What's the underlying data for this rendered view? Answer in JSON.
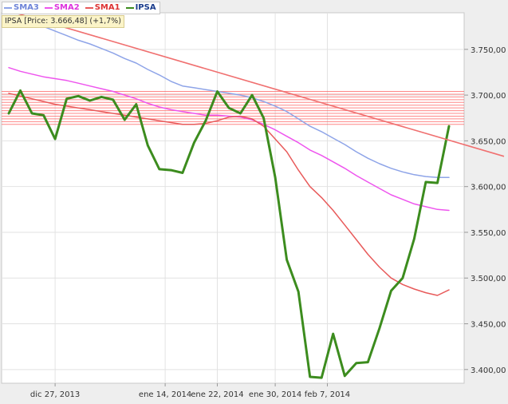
{
  "legend": [
    {
      "name": "SMA3",
      "color": "#8ea4e8"
    },
    {
      "name": "SMA2",
      "color": "#ee55ee"
    },
    {
      "name": "SMA1",
      "color": "#e85a5a"
    },
    {
      "name": "IPSA",
      "color": "#3c8c1e"
    }
  ],
  "price_tag": "IPSA [Price: 3.666,48] (+1,7%)",
  "chart_data": {
    "type": "line",
    "title": "",
    "xlabel": "",
    "ylabel": "",
    "ylim": [
      3385,
      3790
    ],
    "y_ticks": [
      3400,
      3450,
      3500,
      3550,
      3600,
      3650,
      3700,
      3750
    ],
    "y_tick_labels": [
      "3.400,00",
      "3.450,00",
      "3.500,00",
      "3.550,00",
      "3.600,00",
      "3.650,00",
      "3.700,00",
      "3.750,00"
    ],
    "x_tick_labels": [
      "dic 27, 2013",
      "ene 14, 2014",
      "ene 22, 2014",
      "ene 30, 2014",
      "feb 7, 2014"
    ],
    "x_tick_index": [
      4,
      13.5,
      18,
      23,
      27.5
    ],
    "grid": true,
    "legend_position": "top-left",
    "series": [
      {
        "name": "IPSA",
        "color": "#3c8c1e",
        "values": [
          3680,
          3705,
          3680,
          3678,
          3652,
          3696,
          3699,
          3694,
          3698,
          3695,
          3673,
          3690,
          3645,
          3619,
          3618,
          3615,
          3648,
          3672,
          3704,
          3686,
          3680,
          3700,
          3675,
          3610,
          3520,
          3485,
          3392,
          3391,
          3439,
          3393,
          3407,
          3408,
          3445,
          3486,
          3500,
          3543,
          3605,
          3604,
          3666
        ]
      },
      {
        "name": "SMA3",
        "color": "#8ea4e8",
        "values": [
          3786,
          3783,
          3779,
          3775,
          3770,
          3765,
          3760,
          3756,
          3751,
          3746,
          3740,
          3735,
          3728,
          3722,
          3715,
          3710,
          3708,
          3706,
          3704,
          3702,
          3700,
          3697,
          3693,
          3688,
          3682,
          3674,
          3666,
          3660,
          3653,
          3646,
          3638,
          3631,
          3625,
          3620,
          3616,
          3613,
          3611,
          3610,
          3610
        ]
      },
      {
        "name": "SMA2",
        "color": "#ee55ee",
        "values": [
          3730,
          3726,
          3723,
          3720,
          3718,
          3716,
          3713,
          3710,
          3707,
          3704,
          3700,
          3696,
          3691,
          3687,
          3684,
          3682,
          3680,
          3678,
          3678,
          3677,
          3676,
          3673,
          3668,
          3662,
          3655,
          3648,
          3640,
          3634,
          3627,
          3620,
          3612,
          3605,
          3598,
          3591,
          3586,
          3581,
          3578,
          3575,
          3574
        ]
      },
      {
        "name": "SMA1",
        "color": "#e85a5a",
        "values": [
          3702,
          3699,
          3696,
          3693,
          3690,
          3688,
          3686,
          3684,
          3682,
          3680,
          3678,
          3676,
          3674,
          3672,
          3670,
          3668,
          3668,
          3669,
          3672,
          3676,
          3677,
          3674,
          3666,
          3652,
          3638,
          3618,
          3600,
          3588,
          3574,
          3558,
          3542,
          3526,
          3512,
          3500,
          3493,
          3488,
          3484,
          3481,
          3487
        ]
      }
    ],
    "trendline": {
      "color": "#f07070",
      "from": [
        0,
        3792
      ],
      "to": [
        39,
        3647
      ]
    },
    "resistance_band": {
      "color": "#ff6060",
      "levels": [
        3668,
        3671,
        3674,
        3677,
        3680,
        3683,
        3686,
        3689,
        3692,
        3695,
        3698,
        3701,
        3704
      ]
    }
  }
}
